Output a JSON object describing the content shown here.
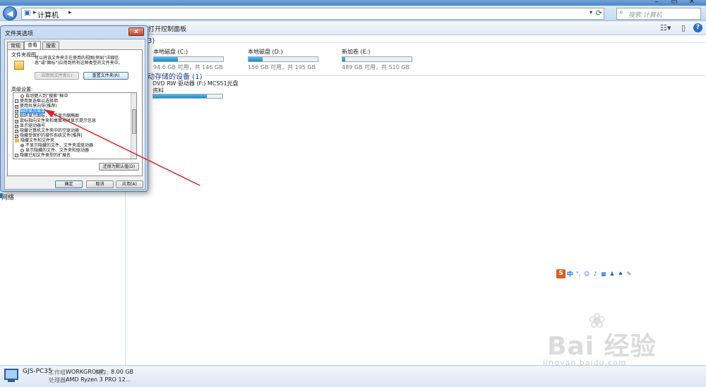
{
  "window": {
    "address_path": "计算机",
    "search_placeholder": "搜索 计算机",
    "toolbar_item": "打开控制面板",
    "help_label": "?"
  },
  "nav": {
    "network_label": "网络"
  },
  "content": {
    "hdd_header": "3)",
    "drives": [
      {
        "name": "本地磁盘 (C:)",
        "free": "94.6 GB 可用，共 146 GB",
        "used_fraction": 0.35
      },
      {
        "name": "本地磁盘 (D:)",
        "free": "156 GB 可用，共 195 GB",
        "used_fraction": 0.2
      },
      {
        "name": "新加卷 (E:)",
        "free": "489 GB 可用，共 510 GB",
        "used_fraction": 0.04
      }
    ],
    "removable_header": "动存储的设备 (1)",
    "dvd": {
      "name": "DVD RW 驱动器 (F:) MCS51光盘",
      "sub": "资料",
      "used_fraction": 0.78
    }
  },
  "status": {
    "computer_name": "GJS-PC35",
    "workgroup_label": "工作组:",
    "workgroup": "WORKGROUP",
    "memory_label": "内存:",
    "memory": "8.00 GB",
    "cpu_label": "处理器:",
    "cpu": "AMD Ryzen 3 PRO 12..."
  },
  "ime": {
    "logo": "S",
    "lang": "中"
  },
  "watermark": {
    "text": "Bai 经验",
    "url": "jingyan.baidu.com"
  },
  "dialog": {
    "title": "文件夹选项",
    "close": "x",
    "tabs": [
      "常规",
      "查看",
      "搜索"
    ],
    "active_tab": "查看",
    "folder_view_label": "文件夹视图",
    "folder_view_desc": "可以将该文件夹正在使用的视图(例如\"详细信息\"或\"图标\")应用到所有这种类型的文件夹中。",
    "apply_to_folders": "应用到文件夹(L)",
    "reset_folders": "重置文件夹(R)",
    "advanced_label": "高级设置:",
    "advanced_items": [
      {
        "kind": "radio",
        "checked": false,
        "indent": 2,
        "text": "自动键入到“搜索”框中"
      },
      {
        "kind": "check",
        "checked": false,
        "indent": 0,
        "text": "使用复选框以选择项"
      },
      {
        "kind": "check",
        "checked": true,
        "indent": 0,
        "text": "使用共享向导(推荐)"
      },
      {
        "kind": "check",
        "checked": true,
        "indent": 0,
        "text": "始终显示菜单",
        "selected": true
      },
      {
        "kind": "check",
        "checked": false,
        "indent": 0,
        "text": "始终显示图标，从不显示缩略图"
      },
      {
        "kind": "check",
        "checked": true,
        "indent": 0,
        "text": "鼠标指向文件夹和桌面项时显示提示信息"
      },
      {
        "kind": "check",
        "checked": true,
        "indent": 0,
        "text": "显示驱动器号"
      },
      {
        "kind": "check",
        "checked": true,
        "indent": 0,
        "text": "隐藏计算机文件夹中的空驱动器"
      },
      {
        "kind": "check",
        "checked": true,
        "indent": 0,
        "text": "隐藏受保护的操作系统文件(推荐)"
      },
      {
        "kind": "folder",
        "checked": false,
        "indent": 0,
        "text": "隐藏文件和文件夹"
      },
      {
        "kind": "radio",
        "checked": true,
        "indent": 2,
        "text": "不显示隐藏的文件、文件夹或驱动器"
      },
      {
        "kind": "radio",
        "checked": false,
        "indent": 2,
        "text": "显示隐藏的文件、文件夹和驱动器"
      },
      {
        "kind": "check",
        "checked": false,
        "indent": 0,
        "text": "隐藏已知文件类型的扩展名"
      }
    ],
    "restore_defaults": "还原为默认值(D)",
    "ok": "确定",
    "cancel": "取消",
    "apply": "应用(A)"
  },
  "colors": {
    "annotation_arrow": "#e02020",
    "drive_fill": "#1e8bc9",
    "selection": "#3399ff"
  }
}
